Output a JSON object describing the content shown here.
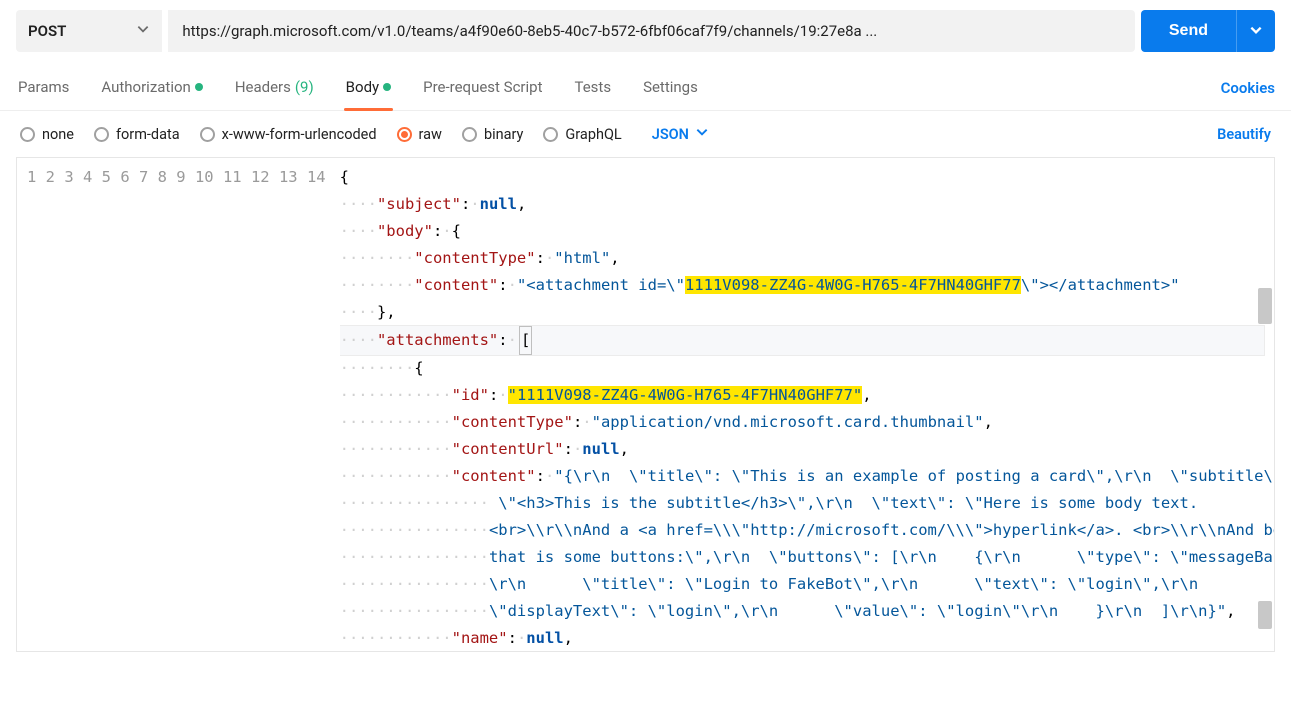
{
  "request": {
    "method": "POST",
    "url": "https://graph.microsoft.com/v1.0/teams/a4f90e60-8eb5-40c7-b572-6fbf06caf7f9/channels/19:27e8a ...",
    "send_label": "Send"
  },
  "tabs": {
    "params": "Params",
    "authorization": "Authorization",
    "headers": "Headers",
    "headers_count": "(9)",
    "body": "Body",
    "pre_request": "Pre-request Script",
    "tests": "Tests",
    "settings": "Settings",
    "cookies": "Cookies"
  },
  "body_types": {
    "none": "none",
    "form_data": "form-data",
    "urlencoded": "x-www-form-urlencoded",
    "raw": "raw",
    "binary": "binary",
    "graphql": "GraphQL",
    "lang": "JSON",
    "beautify": "Beautify"
  },
  "code": {
    "id_highlight": "1111V098-ZZ4G-4W0G-H765-4F7HN40GHF77",
    "line1": "{",
    "l2_key": "\"subject\"",
    "l2_val": "null",
    "l3_key": "\"body\"",
    "l4_key": "\"contentType\"",
    "l4_val": "\"html\"",
    "l5_key": "\"content\"",
    "l5_pre": "\"<attachment id=\\\"",
    "l5_post": "\\\"></attachment>\"",
    "l7_key": "\"attachments\"",
    "l9_key": "\"id\"",
    "l10_key": "\"contentType\"",
    "l10_val": "\"application/vnd.microsoft.card.thumbnail\"",
    "l11_key": "\"contentUrl\"",
    "l11_val": "null",
    "l12_key": "\"content\"",
    "l12_a": "\"{\\r\\n  \\\"title\\\": \\\"This is an example of posting a card\\\",\\r\\n  \\\"subtitle\\\":",
    "l12_b": " \\\"<h3>This is the subtitle</h3>\\\",\\r\\n  \\\"text\\\": \\\"Here is some body text. ",
    "l12_c": "<br>\\\\r\\\\nAnd a <a href=\\\\\\\"http://microsoft.com/\\\\\\\">hyperlink</a>. <br>\\\\r\\\\nAnd below ",
    "l12_d": "that is some buttons:\\\",\\r\\n  \\\"buttons\\\": [\\r\\n    {\\r\\n      \\\"type\\\": \\\"messageBack\\\",",
    "l12_e": "\\r\\n      \\\"title\\\": \\\"Login to FakeBot\\\",\\r\\n      \\\"text\\\": \\\"login\\\",\\r\\n      ",
    "l12_f": "\\\"displayText\\\": \\\"login\\\",\\r\\n      \\\"value\\\": \\\"login\\\"\\r\\n    }\\r\\n  ]\\r\\n}\"",
    "l13_key": "\"name\"",
    "l13_val": "null"
  },
  "chart_data": null
}
